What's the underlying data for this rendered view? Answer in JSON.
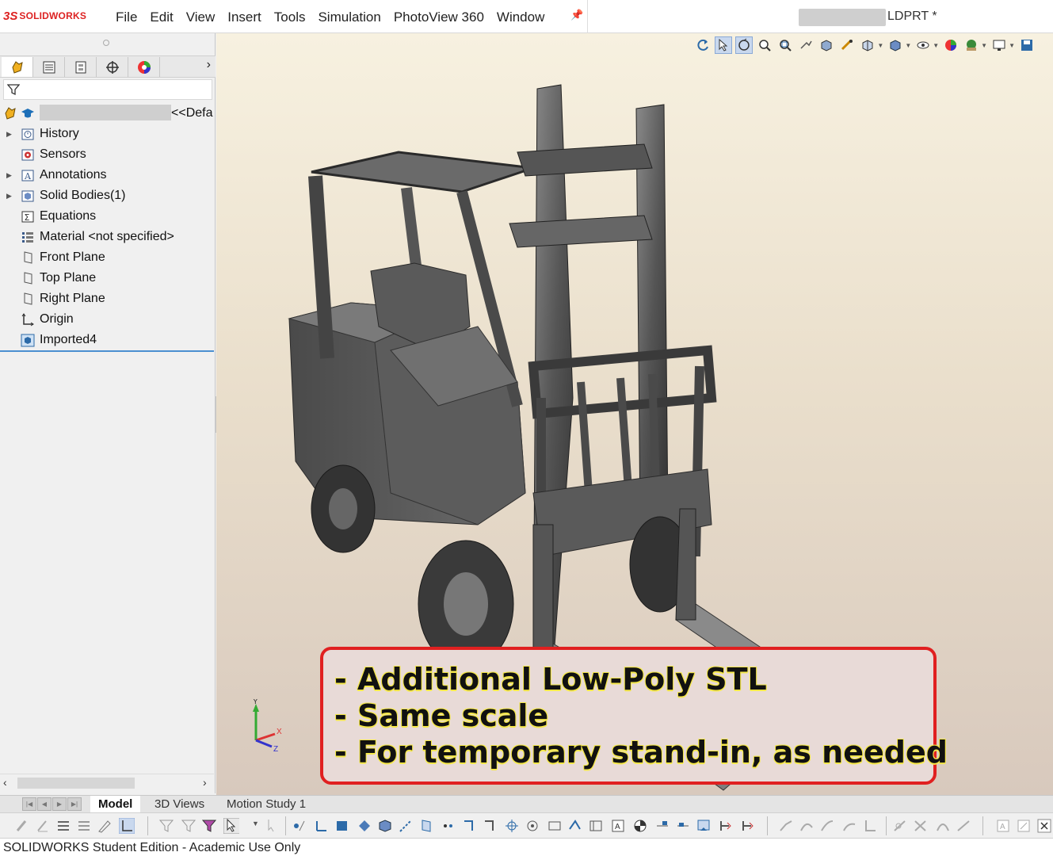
{
  "app": {
    "logo_mark": "3S",
    "logo_text": "SOLIDWORKS",
    "document_title": "LDPRT *"
  },
  "menu": [
    "File",
    "Edit",
    "View",
    "Insert",
    "Tools",
    "Simulation",
    "PhotoView 360",
    "Window"
  ],
  "tree": {
    "root_suffix": "<<Defa",
    "items": [
      {
        "label": "History",
        "icon": "history-icon",
        "expandable": true
      },
      {
        "label": "Sensors",
        "icon": "sensors-icon",
        "expandable": false
      },
      {
        "label": "Annotations",
        "icon": "annotations-icon",
        "expandable": true
      },
      {
        "label": "Solid Bodies(1)",
        "icon": "solid-bodies-icon",
        "expandable": true
      },
      {
        "label": "Equations",
        "icon": "equations-icon",
        "expandable": false
      },
      {
        "label": "Material <not specified>",
        "icon": "material-icon",
        "expandable": false
      },
      {
        "label": "Front Plane",
        "icon": "plane-icon",
        "expandable": false
      },
      {
        "label": "Top Plane",
        "icon": "plane-icon",
        "expandable": false
      },
      {
        "label": "Right Plane",
        "icon": "plane-icon",
        "expandable": false
      },
      {
        "label": "Origin",
        "icon": "origin-icon",
        "expandable": false
      },
      {
        "label": "Imported4",
        "icon": "imported-body-icon",
        "expandable": false
      }
    ]
  },
  "callout": {
    "lines": [
      "- Additional Low-Poly STL",
      "- Same scale",
      "- For temporary stand-in, as needed"
    ],
    "border_color": "#e02020",
    "text_outline_color": "#f5e84a"
  },
  "bottom_tabs": [
    "Model",
    "3D Views",
    "Motion Study 1"
  ],
  "triad": {
    "x": "X",
    "y": "Y",
    "z": "Z"
  },
  "status": "SOLIDWORKS Student Edition - Academic Use Only"
}
